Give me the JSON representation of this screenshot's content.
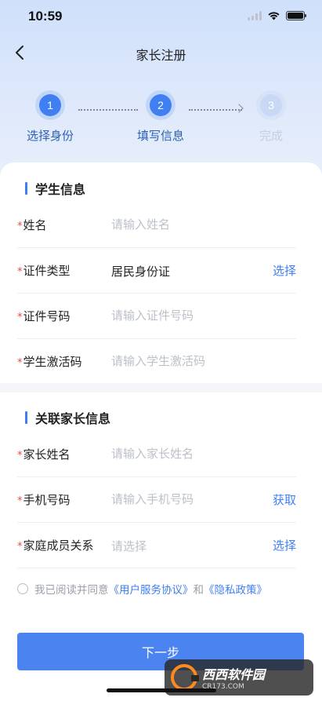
{
  "status_bar": {
    "time": "10:59"
  },
  "nav": {
    "title": "家长注册"
  },
  "steps": [
    {
      "number": "1",
      "label": "选择身份",
      "state": "done"
    },
    {
      "number": "2",
      "label": "填写信息",
      "state": "active"
    },
    {
      "number": "3",
      "label": "完成",
      "state": "pending"
    }
  ],
  "student_section": {
    "title": "学生信息",
    "fields": {
      "name": {
        "label": "姓名",
        "placeholder": "请输入姓名"
      },
      "id_type": {
        "label": "证件类型",
        "value": "居民身份证",
        "action": "选择"
      },
      "id_number": {
        "label": "证件号码",
        "placeholder": "请输入证件号码"
      },
      "activation": {
        "label": "学生激活码",
        "placeholder": "请输入学生激活码"
      }
    }
  },
  "parent_section": {
    "title": "关联家长信息",
    "fields": {
      "parent_name": {
        "label": "家长姓名",
        "placeholder": "请输入家长姓名"
      },
      "phone": {
        "label": "手机号码",
        "placeholder": "请输入手机号码",
        "action": "获取"
      },
      "relation": {
        "label": "家庭成员关系",
        "placeholder": "请选择",
        "action": "选择"
      }
    }
  },
  "agreement": {
    "prefix": "我已阅读并同意",
    "link1": "《用户服务协议》",
    "and": "和",
    "link2": "《隐私政策》"
  },
  "next_button": "下一步",
  "required_mark": "*",
  "watermark": {
    "text": "西西软件园",
    "sub": "CR173.COM"
  },
  "colors": {
    "accent": "#3f7ff1",
    "required": "#e94b3c",
    "button": "#4b84f1"
  }
}
